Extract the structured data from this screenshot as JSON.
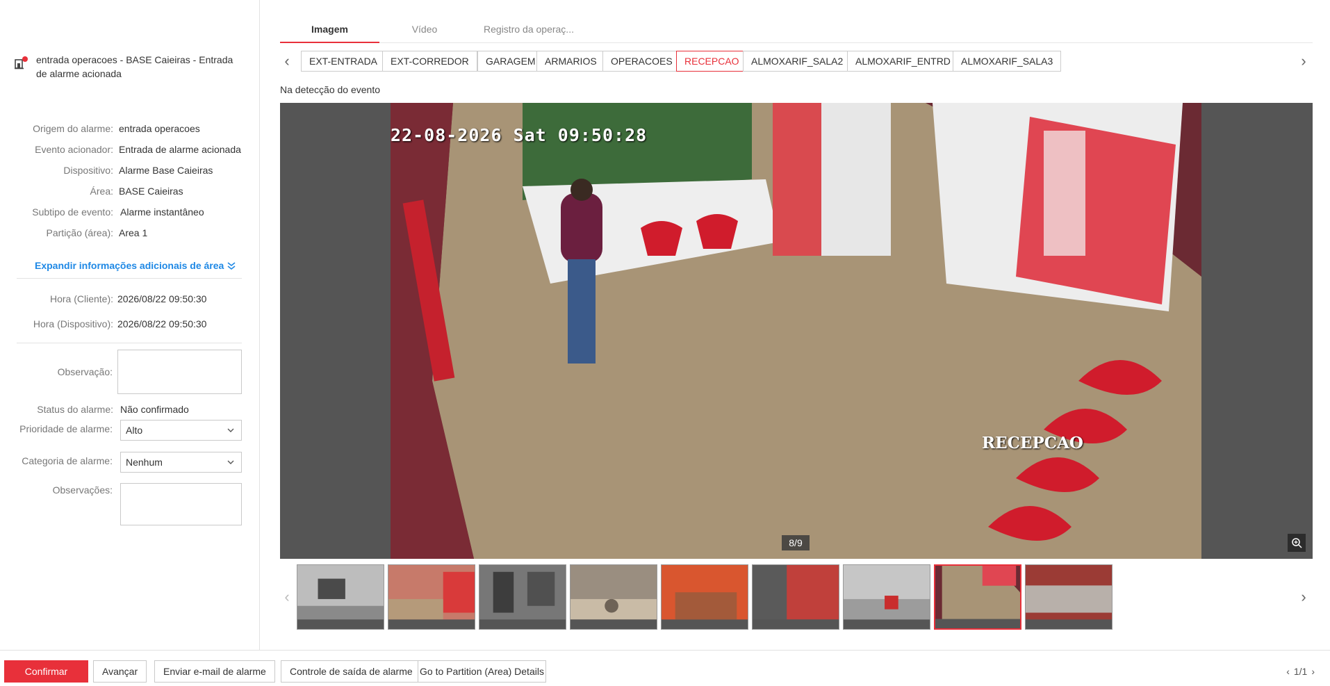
{
  "alarm": {
    "title": "entrada operacoes - BASE Caieiras - Entrada de alarme acionada"
  },
  "details": [
    {
      "label": "Origem do alarme:",
      "value": "entrada operacoes"
    },
    {
      "label": "Evento acionador:",
      "value": "Entrada de alarme acionada"
    },
    {
      "label": "Dispositivo:",
      "value": "Alarme Base Caieiras"
    },
    {
      "label": "Área:",
      "value": "BASE Caieiras"
    },
    {
      "label": "Subtipo de evento:",
      "value": "Alarme instantâneo"
    },
    {
      "label": "Partição (área):",
      "value": "Area 1"
    }
  ],
  "expand_label": "Expandir informações adicionais de área",
  "times": [
    {
      "label": "Hora (Cliente):",
      "value": "2026/08/22 09:50:30"
    },
    {
      "label": "Hora (Dispositivo):",
      "value": "2026/08/22 09:50:30"
    }
  ],
  "form": {
    "observacao_label": "Observação:",
    "observacao_value": "",
    "status_label": "Status do alarme:",
    "status_value": "Não confirmado",
    "prioridade_label": "Prioridade de alarme:",
    "prioridade_value": "Alto",
    "categoria_label": "Categoria de alarme:",
    "categoria_value": "Nenhum",
    "observacoes_label": "Observações:",
    "observacoes_value": ""
  },
  "tabs": [
    "Imagem",
    "Vídeo",
    "Registro da operaç..."
  ],
  "cameras": [
    "EXT-ENTRADA",
    "EXT-CORREDOR",
    "GARAGEM",
    "ARMARIOS",
    "OPERACOES",
    "RECEPCAO",
    "ALMOXARIF_SALA2",
    "ALMOXARIF_ENTRD",
    "ALMOXARIF_SALA3"
  ],
  "active_camera": "RECEPCAO",
  "event_label": "Na detecção do evento",
  "viewer": {
    "osd_time": "22-08-2026 Sat 09:50:28",
    "osd_name": "RECEPCAO",
    "counter": "8/9"
  },
  "thumbnail_count": 9,
  "active_thumbnail": 8,
  "buttons": {
    "confirm": "Confirmar",
    "advance": "Avançar",
    "email": "Enviar e-mail de alarme",
    "output": "Controle de saída de alarme",
    "partition": "Go to Partition (Area) Details"
  },
  "pager": "1/1",
  "colors": {
    "accent": "#e8303a",
    "link": "#1e88e5"
  }
}
